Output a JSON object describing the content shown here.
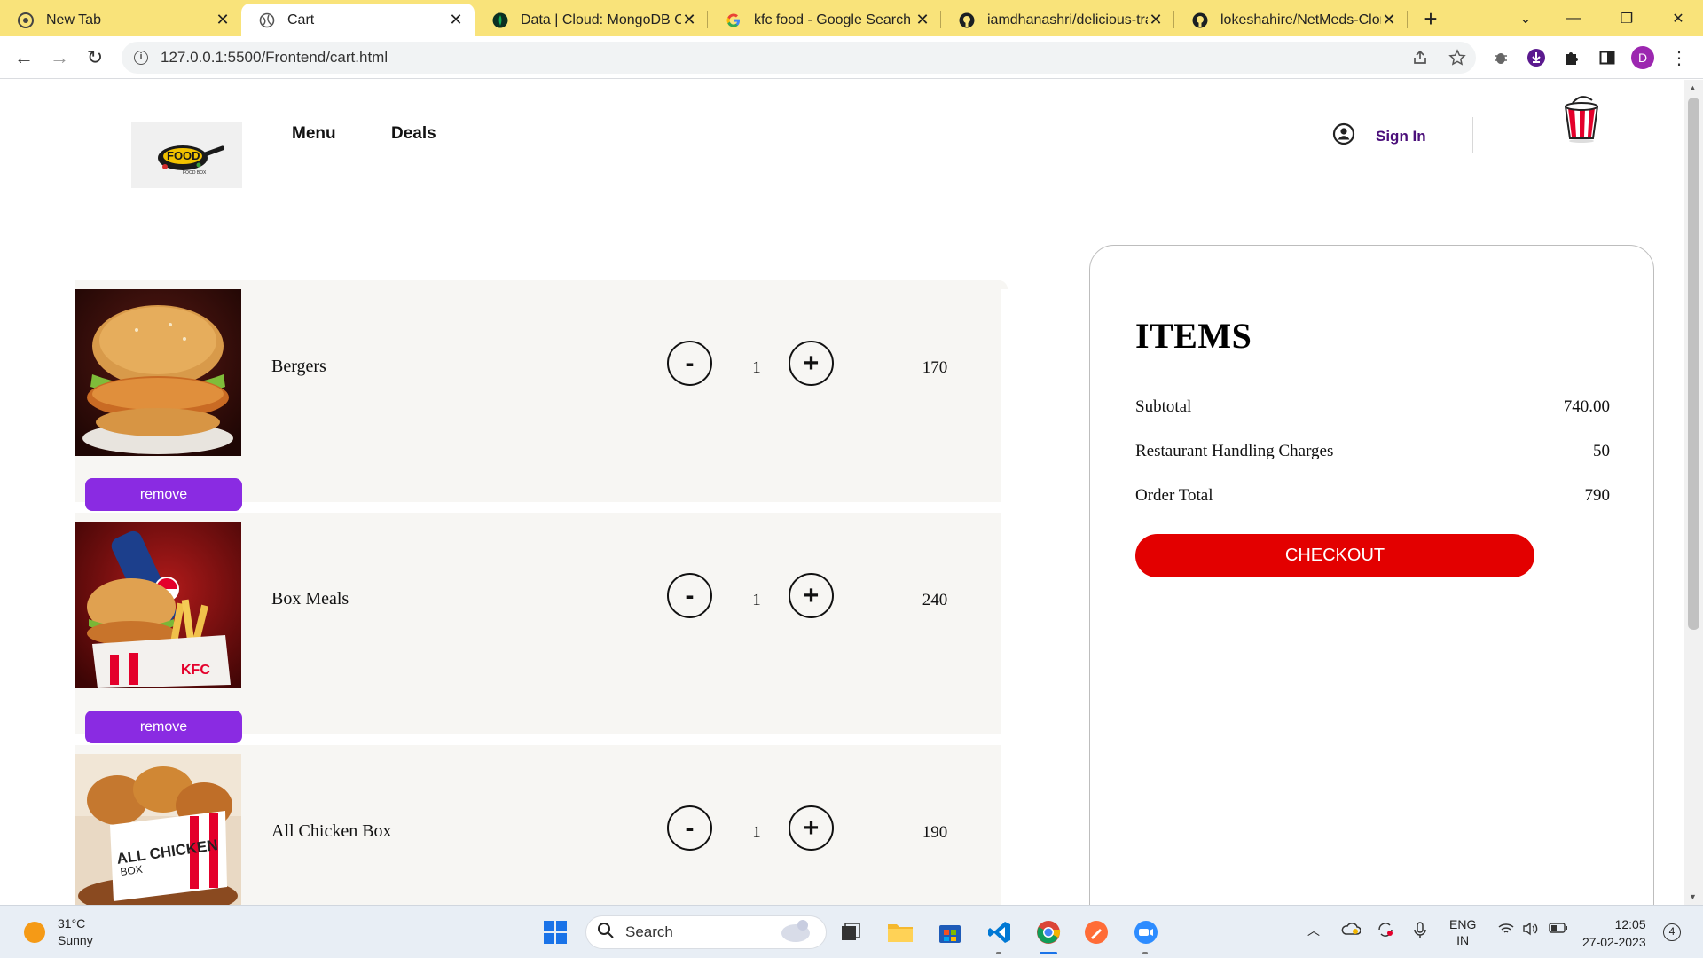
{
  "browser": {
    "tabs": [
      {
        "title": "New Tab",
        "icon": "chrome-icon"
      },
      {
        "title": "Cart",
        "icon": "globe-icon"
      },
      {
        "title": "Data | Cloud: MongoDB Clo",
        "icon": "mongodb-leaf-icon"
      },
      {
        "title": "kfc food - Google Search",
        "icon": "google-icon"
      },
      {
        "title": "iamdhanashri/delicious-tra",
        "icon": "github-icon"
      },
      {
        "title": "lokeshahire/NetMeds-Clon",
        "icon": "github-icon"
      }
    ],
    "active_tab": 1,
    "url": "127.0.0.1:5500/Frontend/cart.html",
    "profile_initial": "D"
  },
  "header": {
    "logo_text": "FOOD",
    "logo_subtext": "FOOD BOX",
    "nav": [
      "Menu",
      "Deals"
    ],
    "signin_label": "Sign In"
  },
  "cart": {
    "remove_label": "remove",
    "items": [
      {
        "name": "Bergers",
        "qty": "1",
        "price": "170",
        "image": "burger"
      },
      {
        "name": "Box Meals",
        "qty": "1",
        "price": "240",
        "image": "box-meal"
      },
      {
        "name": "All Chicken Box",
        "qty": "1",
        "price": "190",
        "image": "chicken-box",
        "image_text": "ALL CHICKEN",
        "image_subtext": "BOX"
      }
    ],
    "minus_label": "-",
    "plus_label": "+"
  },
  "summary": {
    "title": "ITEMS",
    "subtotal_label": "Subtotal",
    "subtotal_value": "740.00",
    "handling_label": "Restaurant Handling Charges",
    "handling_value": "50",
    "total_label": "Order Total",
    "total_value": "790",
    "checkout_label": "CHECKOUT"
  },
  "taskbar": {
    "weather_temp": "31°C",
    "weather_desc": "Sunny",
    "search_placeholder": "Search",
    "lang_top": "ENG",
    "lang_bottom": "IN",
    "time": "12:05",
    "date": "27-02-2023",
    "notification_count": "4"
  },
  "colors": {
    "tabstrip": "#f9e37a",
    "remove_button": "#8a2be2",
    "checkout_button": "#e30000",
    "signin_text": "#4a0e7a",
    "cart_row_bg": "#f7f6f3"
  }
}
